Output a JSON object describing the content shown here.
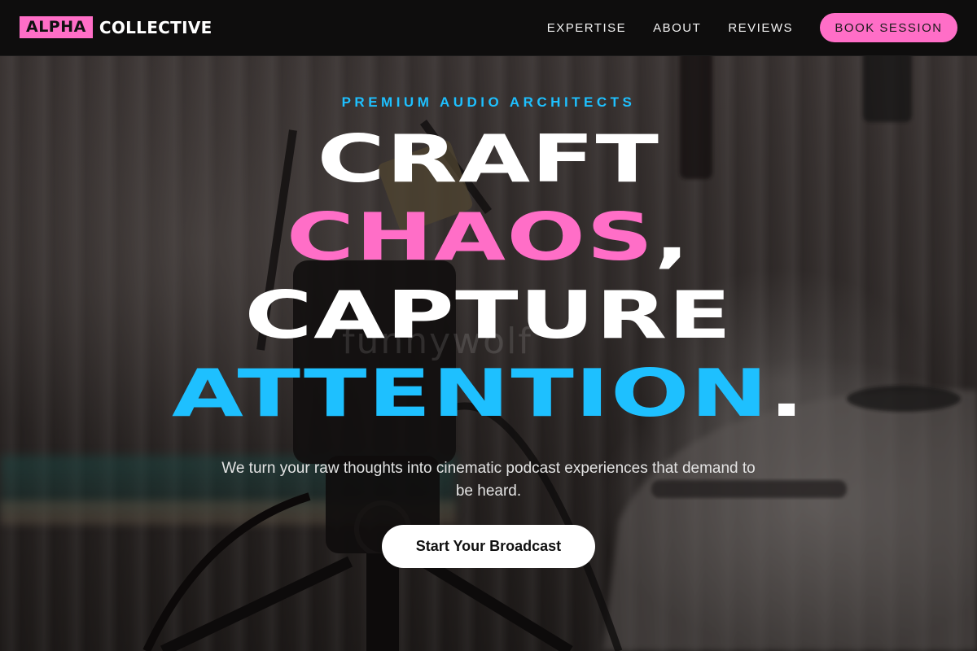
{
  "brand": {
    "logo_highlight": "ALPHA",
    "logo_rest": "COLLECTIVE"
  },
  "nav": {
    "links": [
      "EXPERTISE",
      "ABOUT",
      "REVIEWS"
    ],
    "cta_label": "BOOK SESSION"
  },
  "hero": {
    "eyebrow": "PREMIUM AUDIO ARCHITECTS",
    "headline": {
      "line1": "CRAFT",
      "line2_word": "CHAOS",
      "line2_punct": ",",
      "line3": "CAPTURE",
      "line4_word": "ATTENTION",
      "line4_punct": "."
    },
    "watermark": "funnywolf",
    "subtitle": "We turn your raw thoughts into cinematic podcast experiences that demand to be heard.",
    "cta_label": "Start Your Broadcast"
  },
  "colors": {
    "accent_pink": "#ff6ec7",
    "accent_blue": "#1ec0ff",
    "nav_background": "#0e0d0d"
  }
}
